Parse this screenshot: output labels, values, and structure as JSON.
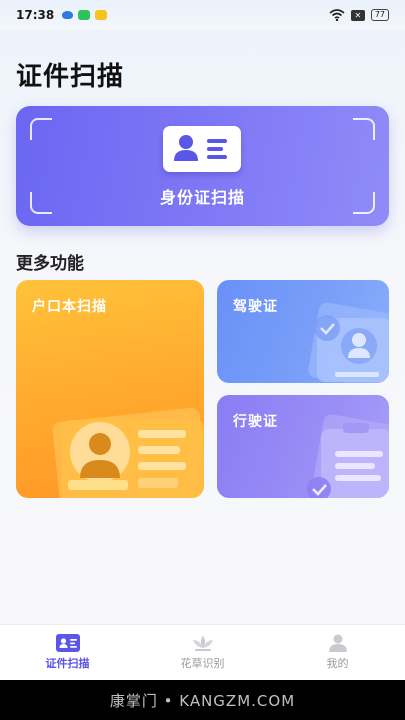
{
  "status_bar": {
    "time": "17:38",
    "battery": "77"
  },
  "header": {
    "title": "证件扫描"
  },
  "hero": {
    "label": "身份证扫描"
  },
  "more": {
    "title": "更多功能",
    "cards": [
      {
        "label": "户口本扫描"
      },
      {
        "label": "驾驶证"
      },
      {
        "label": "行驶证"
      }
    ]
  },
  "bottom_nav": {
    "items": [
      {
        "label": "证件扫描",
        "icon": "id-card-icon",
        "active": true
      },
      {
        "label": "花草识别",
        "icon": "lotus-icon",
        "active": false
      },
      {
        "label": "我的",
        "icon": "person-icon",
        "active": false
      }
    ]
  },
  "watermark": {
    "text": "康掌门 • KANGZM.COM"
  },
  "colors": {
    "accent": "#5b55e8",
    "hero": "#7570f5",
    "hukou": "#ffab2e",
    "jiashi": "#7aa0f9",
    "xingshi": "#9a8ef6"
  }
}
